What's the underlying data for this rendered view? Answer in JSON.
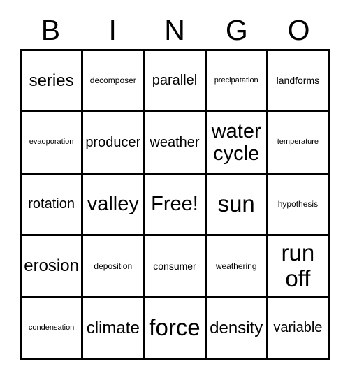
{
  "card": {
    "title": "BINGO",
    "header_letters": [
      "B",
      "I",
      "N",
      "G",
      "O"
    ],
    "colors": {
      "background": "#ffffff",
      "border": "#000000",
      "text": "#000000"
    },
    "grid": {
      "rows": 5,
      "columns": 5,
      "free_space_label": "Free!",
      "free_space_position": "row3-col3"
    },
    "cells": [
      {
        "id": "b1",
        "column": "B",
        "row": 1,
        "text": "series",
        "size": "lg",
        "lines": 1
      },
      {
        "id": "i1",
        "column": "I",
        "row": 1,
        "text": "decomposer",
        "size": "xs",
        "lines": 1
      },
      {
        "id": "n1",
        "column": "N",
        "row": 1,
        "text": "parallel",
        "size": "md",
        "lines": 1
      },
      {
        "id": "g1",
        "column": "G",
        "row": 1,
        "text": "precipatation",
        "size": "xxs",
        "lines": 1
      },
      {
        "id": "o1",
        "column": "O",
        "row": 1,
        "text": "landforms",
        "size": "sm",
        "lines": 1
      },
      {
        "id": "b2",
        "column": "B",
        "row": 2,
        "text": "evaoporation",
        "size": "xxs",
        "lines": 1
      },
      {
        "id": "i2",
        "column": "I",
        "row": 2,
        "text": "producer",
        "size": "md",
        "lines": 1
      },
      {
        "id": "n2",
        "column": "N",
        "row": 2,
        "text": "weather",
        "size": "md",
        "lines": 1
      },
      {
        "id": "g2",
        "column": "G",
        "row": 2,
        "text": "water\ncycle",
        "size": "xl",
        "lines": 2
      },
      {
        "id": "o2",
        "column": "O",
        "row": 2,
        "text": "temperature",
        "size": "xxs",
        "lines": 1
      },
      {
        "id": "b3",
        "column": "B",
        "row": 3,
        "text": "rotation",
        "size": "md",
        "lines": 1
      },
      {
        "id": "i3",
        "column": "I",
        "row": 3,
        "text": "valley",
        "size": "xl",
        "lines": 1
      },
      {
        "id": "n3",
        "column": "N",
        "row": 3,
        "text": "Free!",
        "size": "xl",
        "lines": 1
      },
      {
        "id": "g3",
        "column": "G",
        "row": 3,
        "text": "sun",
        "size": "xxl",
        "lines": 1
      },
      {
        "id": "o3",
        "column": "O",
        "row": 3,
        "text": "hypothesis",
        "size": "xs",
        "lines": 1
      },
      {
        "id": "b4",
        "column": "B",
        "row": 4,
        "text": "erosion",
        "size": "lg",
        "lines": 1
      },
      {
        "id": "i4",
        "column": "I",
        "row": 4,
        "text": "deposition",
        "size": "xs",
        "lines": 1
      },
      {
        "id": "n4",
        "column": "N",
        "row": 4,
        "text": "consumer",
        "size": "sm",
        "lines": 1
      },
      {
        "id": "g4",
        "column": "G",
        "row": 4,
        "text": "weathering",
        "size": "xs",
        "lines": 1
      },
      {
        "id": "o4",
        "column": "O",
        "row": 4,
        "text": "run\noff",
        "size": "xxl",
        "lines": 2
      },
      {
        "id": "b5",
        "column": "B",
        "row": 5,
        "text": "condensation",
        "size": "xxs",
        "lines": 1
      },
      {
        "id": "i5",
        "column": "I",
        "row": 5,
        "text": "climate",
        "size": "lg",
        "lines": 1
      },
      {
        "id": "n5",
        "column": "N",
        "row": 5,
        "text": "force",
        "size": "xxl",
        "lines": 1
      },
      {
        "id": "g5",
        "column": "G",
        "row": 5,
        "text": "density",
        "size": "lg",
        "lines": 1
      },
      {
        "id": "o5",
        "column": "O",
        "row": 5,
        "text": "variable",
        "size": "md",
        "lines": 1
      }
    ]
  }
}
